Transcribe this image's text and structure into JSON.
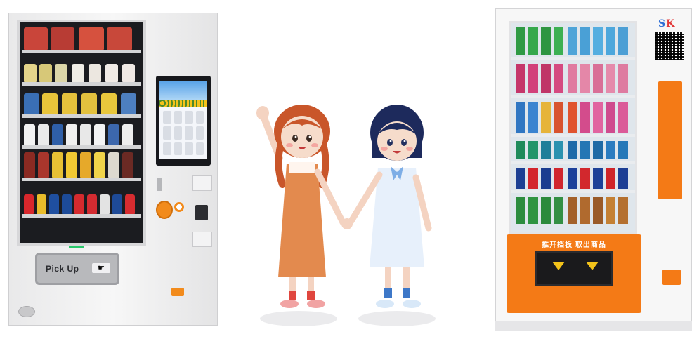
{
  "left_machine": {
    "pickup_label": "Pick Up"
  },
  "right_machine": {
    "panel_text": "推开挡板 取出商品",
    "brand_s": "S",
    "brand_k": "K"
  },
  "colors": {
    "accent_orange": "#f47a16",
    "green_led": "#29c96b",
    "girl_hair": "#c9562a",
    "girl_dress": "#e38a4e",
    "boy_hair": "#1d2a5c",
    "boy_dress": "#e7f0fb"
  }
}
